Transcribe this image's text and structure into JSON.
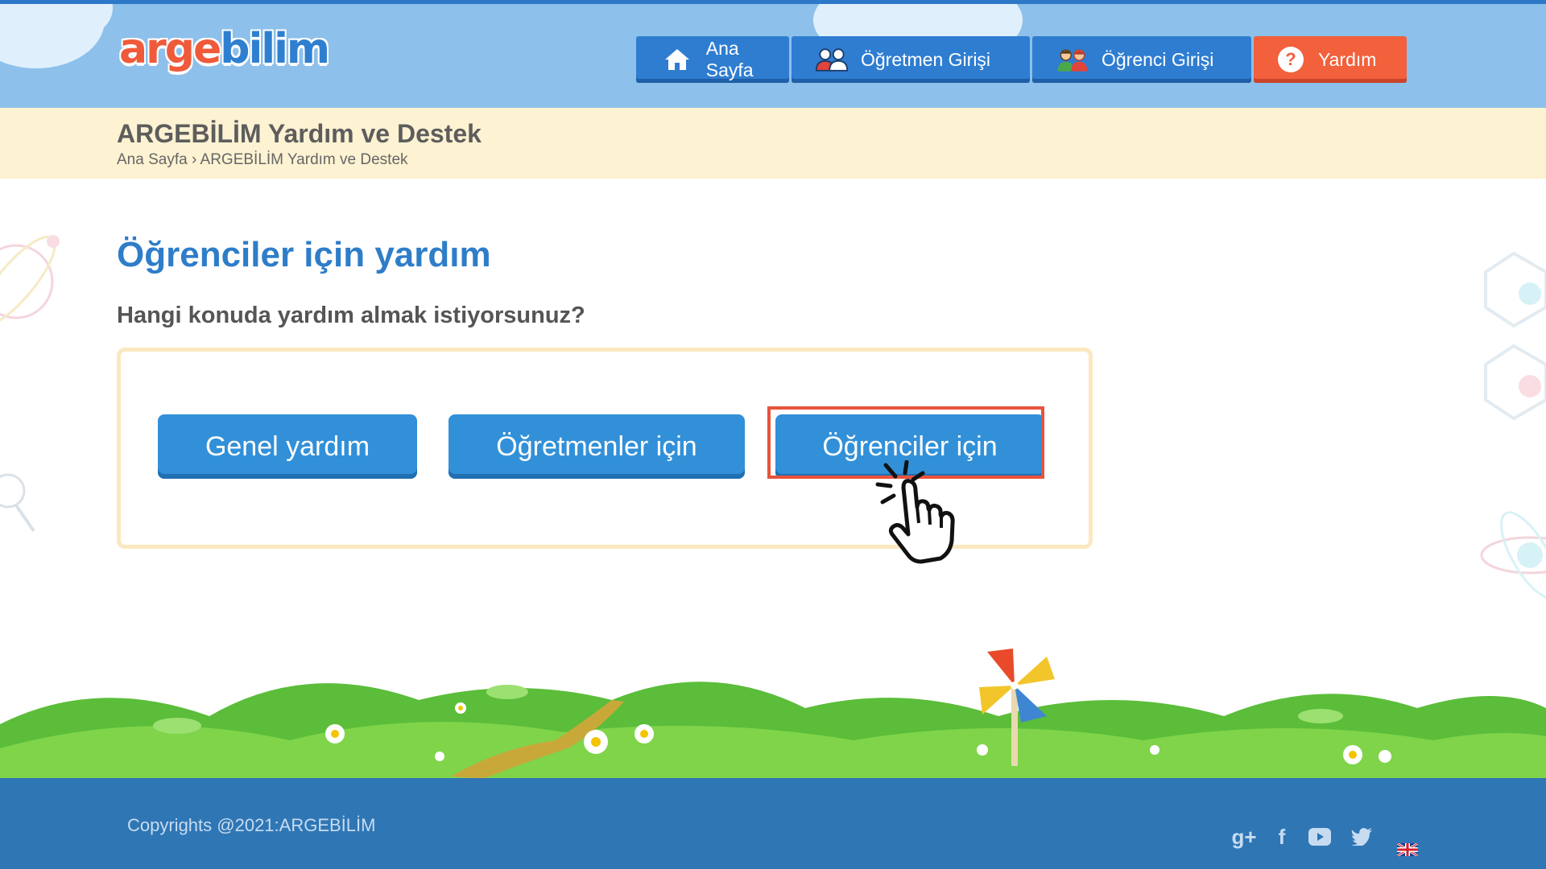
{
  "brand": {
    "logo_part1": "arge",
    "logo_part2": "bilim",
    "logo_color_1": "#ef5a3a",
    "logo_color_2": "#2f7fd0"
  },
  "nav": {
    "items": [
      {
        "label": "Ana Sayfa",
        "icon": "home-icon"
      },
      {
        "label": "Öğretmen Girişi",
        "icon": "teacher-icon"
      },
      {
        "label": "Öğrenci Girişi",
        "icon": "students-icon"
      },
      {
        "label": "Yardım",
        "icon": "help-icon",
        "icon_text": "?"
      }
    ],
    "active_color": "#f2603c",
    "default_color": "#2e7dd1"
  },
  "titlebar": {
    "title": "ARGEBİLİM Yardım ve Destek",
    "breadcrumb": [
      "Ana Sayfa",
      "ARGEBİLİM Yardım ve Destek"
    ],
    "breadcrumb_separator": "›"
  },
  "main": {
    "heading": "Öğrenciler için yardım",
    "question": "Hangi konuda yardım almak istiyorsunuz?",
    "options": [
      {
        "label": "Genel yardım"
      },
      {
        "label": "Öğretmenler için"
      },
      {
        "label": "Öğrenciler için",
        "highlighted": true
      }
    ]
  },
  "footer": {
    "copyright": "Copyrights @2021:ARGEBİLİM",
    "social": [
      {
        "icon": "google-plus-icon",
        "glyph": "g+"
      },
      {
        "icon": "facebook-icon",
        "glyph": "f"
      },
      {
        "icon": "youtube-icon"
      },
      {
        "icon": "twitter-icon"
      },
      {
        "icon": "english-flag-icon"
      }
    ]
  },
  "colors": {
    "accent_blue": "#3290d8",
    "highlight_border": "#e8533c",
    "footer_bg": "#2f76b5"
  }
}
